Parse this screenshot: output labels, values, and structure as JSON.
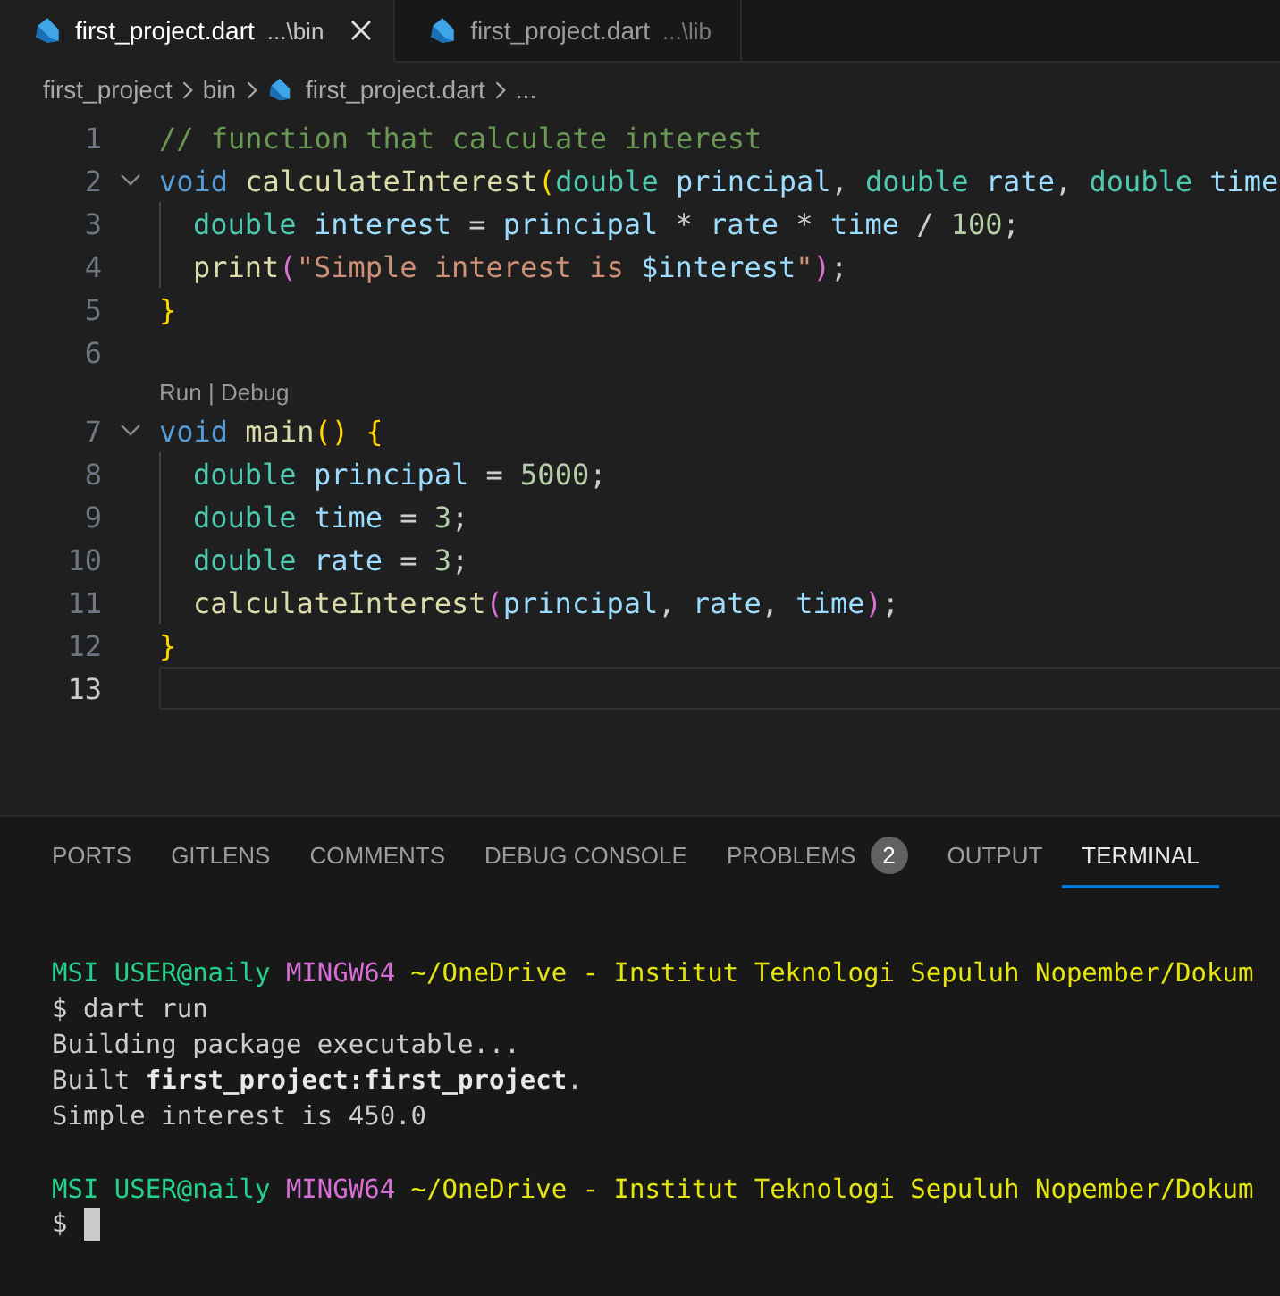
{
  "tabs": [
    {
      "file": "first_project.dart",
      "path": "...\\bin",
      "selected": true
    },
    {
      "file": "first_project.dart",
      "path": "...\\lib",
      "selected": false
    }
  ],
  "breadcrumbs": [
    "first_project",
    "bin",
    "first_project.dart",
    "..."
  ],
  "editor": {
    "lines": [
      {
        "number": "1",
        "foldable": false,
        "indented": false,
        "current": false,
        "tokens": [
          {
            "kind": "comment",
            "text": "// function that calculate interest"
          }
        ]
      },
      {
        "number": "2",
        "foldable": true,
        "indented": false,
        "current": false,
        "tokens": [
          {
            "kind": "keyword",
            "text": "void "
          },
          {
            "kind": "func",
            "text": "calculateInterest"
          },
          {
            "kind": "bracket1",
            "text": "("
          },
          {
            "kind": "type",
            "text": "double "
          },
          {
            "kind": "var",
            "text": "principal"
          },
          {
            "kind": "plain",
            "text": ", "
          },
          {
            "kind": "type",
            "text": "double "
          },
          {
            "kind": "var",
            "text": "rate"
          },
          {
            "kind": "plain",
            "text": ", "
          },
          {
            "kind": "type",
            "text": "double "
          },
          {
            "kind": "var",
            "text": "time"
          }
        ]
      },
      {
        "number": "3",
        "foldable": false,
        "indented": true,
        "current": false,
        "tokens": [
          {
            "kind": "type",
            "text": "double "
          },
          {
            "kind": "var",
            "text": "interest"
          },
          {
            "kind": "plain",
            "text": " = "
          },
          {
            "kind": "var",
            "text": "principal"
          },
          {
            "kind": "plain",
            "text": " * "
          },
          {
            "kind": "var",
            "text": "rate"
          },
          {
            "kind": "plain",
            "text": " * "
          },
          {
            "kind": "var",
            "text": "time"
          },
          {
            "kind": "plain",
            "text": " / "
          },
          {
            "kind": "num",
            "text": "100"
          },
          {
            "kind": "plain",
            "text": ";"
          }
        ]
      },
      {
        "number": "4",
        "foldable": false,
        "indented": true,
        "current": false,
        "tokens": [
          {
            "kind": "func",
            "text": "print"
          },
          {
            "kind": "bracket2",
            "text": "("
          },
          {
            "kind": "str",
            "text": "\"Simple interest is "
          },
          {
            "kind": "var",
            "text": "$interest"
          },
          {
            "kind": "str",
            "text": "\""
          },
          {
            "kind": "bracket2",
            "text": ")"
          },
          {
            "kind": "plain",
            "text": ";"
          }
        ]
      },
      {
        "number": "5",
        "foldable": false,
        "indented": false,
        "current": false,
        "tokens": [
          {
            "kind": "bracket1",
            "text": "}"
          }
        ]
      },
      {
        "number": "6",
        "foldable": false,
        "indented": false,
        "current": false
      },
      {
        "number": "7",
        "foldable": true,
        "indented": false,
        "current": false,
        "codelens": "Run | Debug",
        "tokens": [
          {
            "kind": "keyword",
            "text": "void "
          },
          {
            "kind": "func",
            "text": "main"
          },
          {
            "kind": "bracket1",
            "text": "()"
          },
          {
            "kind": "bracket1",
            "text": " {"
          }
        ]
      },
      {
        "number": "8",
        "foldable": false,
        "indented": true,
        "current": false,
        "tokens": [
          {
            "kind": "type",
            "text": "double "
          },
          {
            "kind": "var",
            "text": "principal"
          },
          {
            "kind": "plain",
            "text": " = "
          },
          {
            "kind": "num",
            "text": "5000"
          },
          {
            "kind": "plain",
            "text": ";"
          }
        ]
      },
      {
        "number": "9",
        "foldable": false,
        "indented": true,
        "current": false,
        "tokens": [
          {
            "kind": "type",
            "text": "double "
          },
          {
            "kind": "var",
            "text": "time"
          },
          {
            "kind": "plain",
            "text": " = "
          },
          {
            "kind": "num",
            "text": "3"
          },
          {
            "kind": "plain",
            "text": ";"
          }
        ]
      },
      {
        "number": "10",
        "foldable": false,
        "indented": true,
        "current": false,
        "tokens": [
          {
            "kind": "type",
            "text": "double "
          },
          {
            "kind": "var",
            "text": "rate"
          },
          {
            "kind": "plain",
            "text": " = "
          },
          {
            "kind": "num",
            "text": "3"
          },
          {
            "kind": "plain",
            "text": ";"
          }
        ]
      },
      {
        "number": "11",
        "foldable": false,
        "indented": true,
        "current": false,
        "tokens": [
          {
            "kind": "func",
            "text": "calculateInterest"
          },
          {
            "kind": "bracket2",
            "text": "("
          },
          {
            "kind": "var",
            "text": "principal"
          },
          {
            "kind": "plain",
            "text": ", "
          },
          {
            "kind": "var",
            "text": "rate"
          },
          {
            "kind": "plain",
            "text": ", "
          },
          {
            "kind": "var",
            "text": "time"
          },
          {
            "kind": "bracket2",
            "text": ")"
          },
          {
            "kind": "plain",
            "text": ";"
          }
        ]
      },
      {
        "number": "12",
        "foldable": false,
        "indented": false,
        "current": false,
        "tokens": [
          {
            "kind": "bracket1",
            "text": "}"
          }
        ]
      },
      {
        "number": "13",
        "foldable": false,
        "indented": false,
        "current": true
      }
    ]
  },
  "panel": {
    "tabs": [
      {
        "label": "PORTS",
        "selected": false
      },
      {
        "label": "GITLENS",
        "selected": false
      },
      {
        "label": "COMMENTS",
        "selected": false
      },
      {
        "label": "DEBUG CONSOLE",
        "selected": false
      },
      {
        "label": "PROBLEMS",
        "badge": "2",
        "selected": false
      },
      {
        "label": "OUTPUT",
        "selected": false
      },
      {
        "label": "TERMINAL",
        "selected": true
      }
    ],
    "terminal": [
      {
        "blank_line_before": false,
        "segments": [
          {
            "kind": "green",
            "text": "MSI USER@naily "
          },
          {
            "kind": "magenta",
            "text": "MINGW64 "
          },
          {
            "kind": "yellow",
            "text": "~/OneDrive - Institut Teknologi Sepuluh Nopember/Dokum"
          }
        ]
      },
      {
        "blank_line_before": false,
        "segments": [
          {
            "kind": "plain",
            "text": "$ dart run"
          }
        ]
      },
      {
        "blank_line_before": false,
        "segments": [
          {
            "kind": "plain",
            "text": "Building package executable..."
          }
        ]
      },
      {
        "blank_line_before": false,
        "segments": [
          {
            "kind": "plain",
            "text": "Built "
          },
          {
            "kind": "bold",
            "text": "first_project:first_project"
          },
          {
            "kind": "plain",
            "text": "."
          }
        ]
      },
      {
        "blank_line_before": false,
        "segments": [
          {
            "kind": "plain",
            "text": "Simple interest is 450.0"
          }
        ]
      },
      {
        "blank_line_before": true,
        "segments": [
          {
            "kind": "green",
            "text": "MSI USER@naily "
          },
          {
            "kind": "magenta",
            "text": "MINGW64 "
          },
          {
            "kind": "yellow",
            "text": "~/OneDrive - Institut Teknologi Sepuluh Nopember/Dokum"
          }
        ]
      },
      {
        "blank_line_before": false,
        "segments": [
          {
            "kind": "plain",
            "text": "$"
          }
        ],
        "cursor": true
      }
    ]
  }
}
